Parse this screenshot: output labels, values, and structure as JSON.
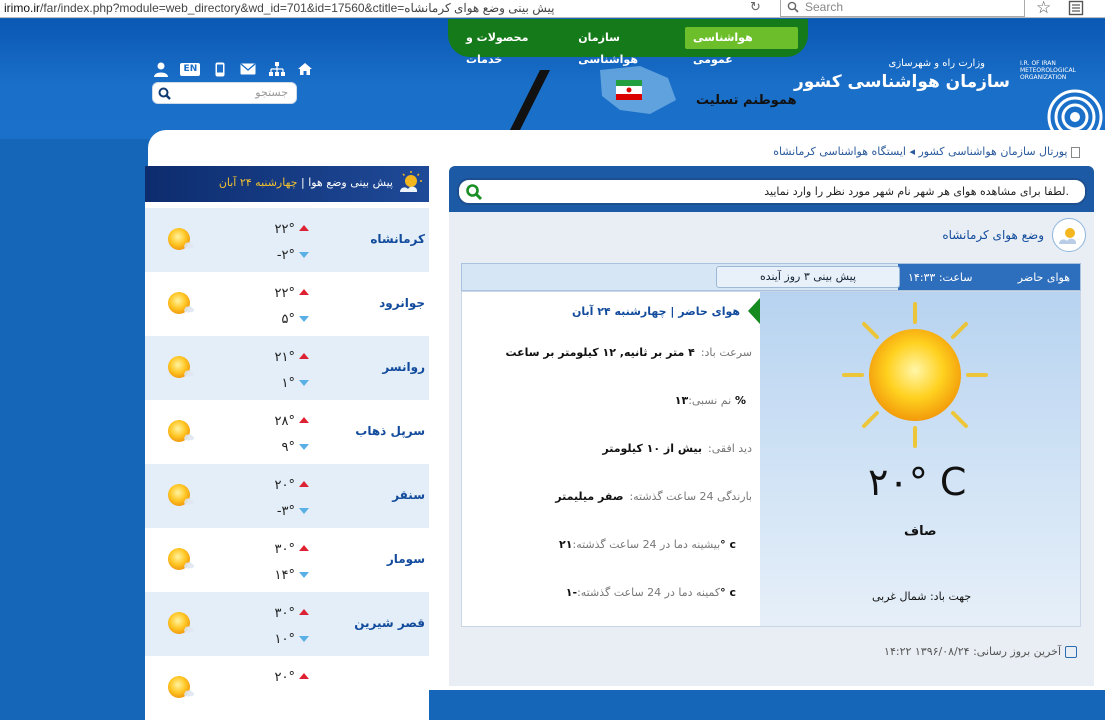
{
  "browser": {
    "url_domain": "irimo.ir",
    "url_rest": "/far/index.php?module=web_directory&wd_id=701&id=17560&ctitle=پیش بینی وضع هوای کرمانشاه",
    "search_placeholder": "Search"
  },
  "header": {
    "nav": [
      "هواشناسی عمومی",
      "سازمان هواشناسی",
      "محصولات و خدمات"
    ],
    "ministry": "وزارت راه و شهرسازی",
    "org_title": "سازمان هواشناسی کشور",
    "org_en": "I.R. OF IRAN METEOROLOGICAL ORGANIZATION",
    "mourning": "هموطنم تسلیت",
    "lang_badge": "EN",
    "search_placeholder": "جستجو"
  },
  "breadcrumb": "پورتال سازمان هواشناسی کشور ◂ ایستگاه هواشناسی کرمانشاه",
  "left": {
    "title": "پیش بینی وضع هوا",
    "date": "چهارشنبه ۲۴ آبان",
    "cities": [
      {
        "name": "کرمانشاه",
        "max": "۲۲°",
        "min": "-۲°"
      },
      {
        "name": "جوانرود",
        "max": "۲۲°",
        "min": "۵°"
      },
      {
        "name": "روانسر",
        "max": "۲۱°",
        "min": "۱°"
      },
      {
        "name": "سرپل ذهاب",
        "max": "۲۸°",
        "min": "۹°"
      },
      {
        "name": "سنقر",
        "max": "۲۰°",
        "min": "-۳°"
      },
      {
        "name": "سومار",
        "max": "۳۰°",
        "min": "۱۴°"
      },
      {
        "name": "قصر شیرین",
        "max": "۳۰°",
        "min": "۱۰°"
      },
      {
        "name": "",
        "max": "۲۰°",
        "min": ""
      }
    ]
  },
  "right": {
    "search_text": "لطفا برای مشاهده هوای هر شهر نام شهر مورد نظر را وارد نمایید.",
    "station": "وضع هوای کرمانشاه",
    "tab_now": "هوای حاضر",
    "tab_time": "ساعت: ۱۴:۳۳",
    "tab_forecast": "پیش بینی ۳ روز آینده",
    "now_head": "هوای حاضر | چهارشنبه ۲۴ آبان",
    "wind_speed_label": "سرعت باد:",
    "wind_speed": "۴ متر بر ثانیه, ۱۲ کیلومتر بر ساعت",
    "humidity_label": "نم نسبی:",
    "humidity": "۱۳ %",
    "visibility_label": "دید افقی:",
    "visibility": "بیش از ۱۰ کیلومتر",
    "rain_label": "بارندگی 24 ساعت گذشته:",
    "rain": "صفر میلیمتر",
    "max_label": "بیشینه دما در 24 ساعت گذشته:",
    "max": "۲۱° c",
    "min_label": "کمینه دما در 24 ساعت گذشته:",
    "min": "-۱° c",
    "big_temp": "۲۰° C",
    "condition": "صاف",
    "wind_dir": "جهت باد: شمال غربی",
    "last_update": "آخرین بروز رسانی: ۱۳۹۶/۰۸/۲۴ ۱۴:۲۲"
  }
}
